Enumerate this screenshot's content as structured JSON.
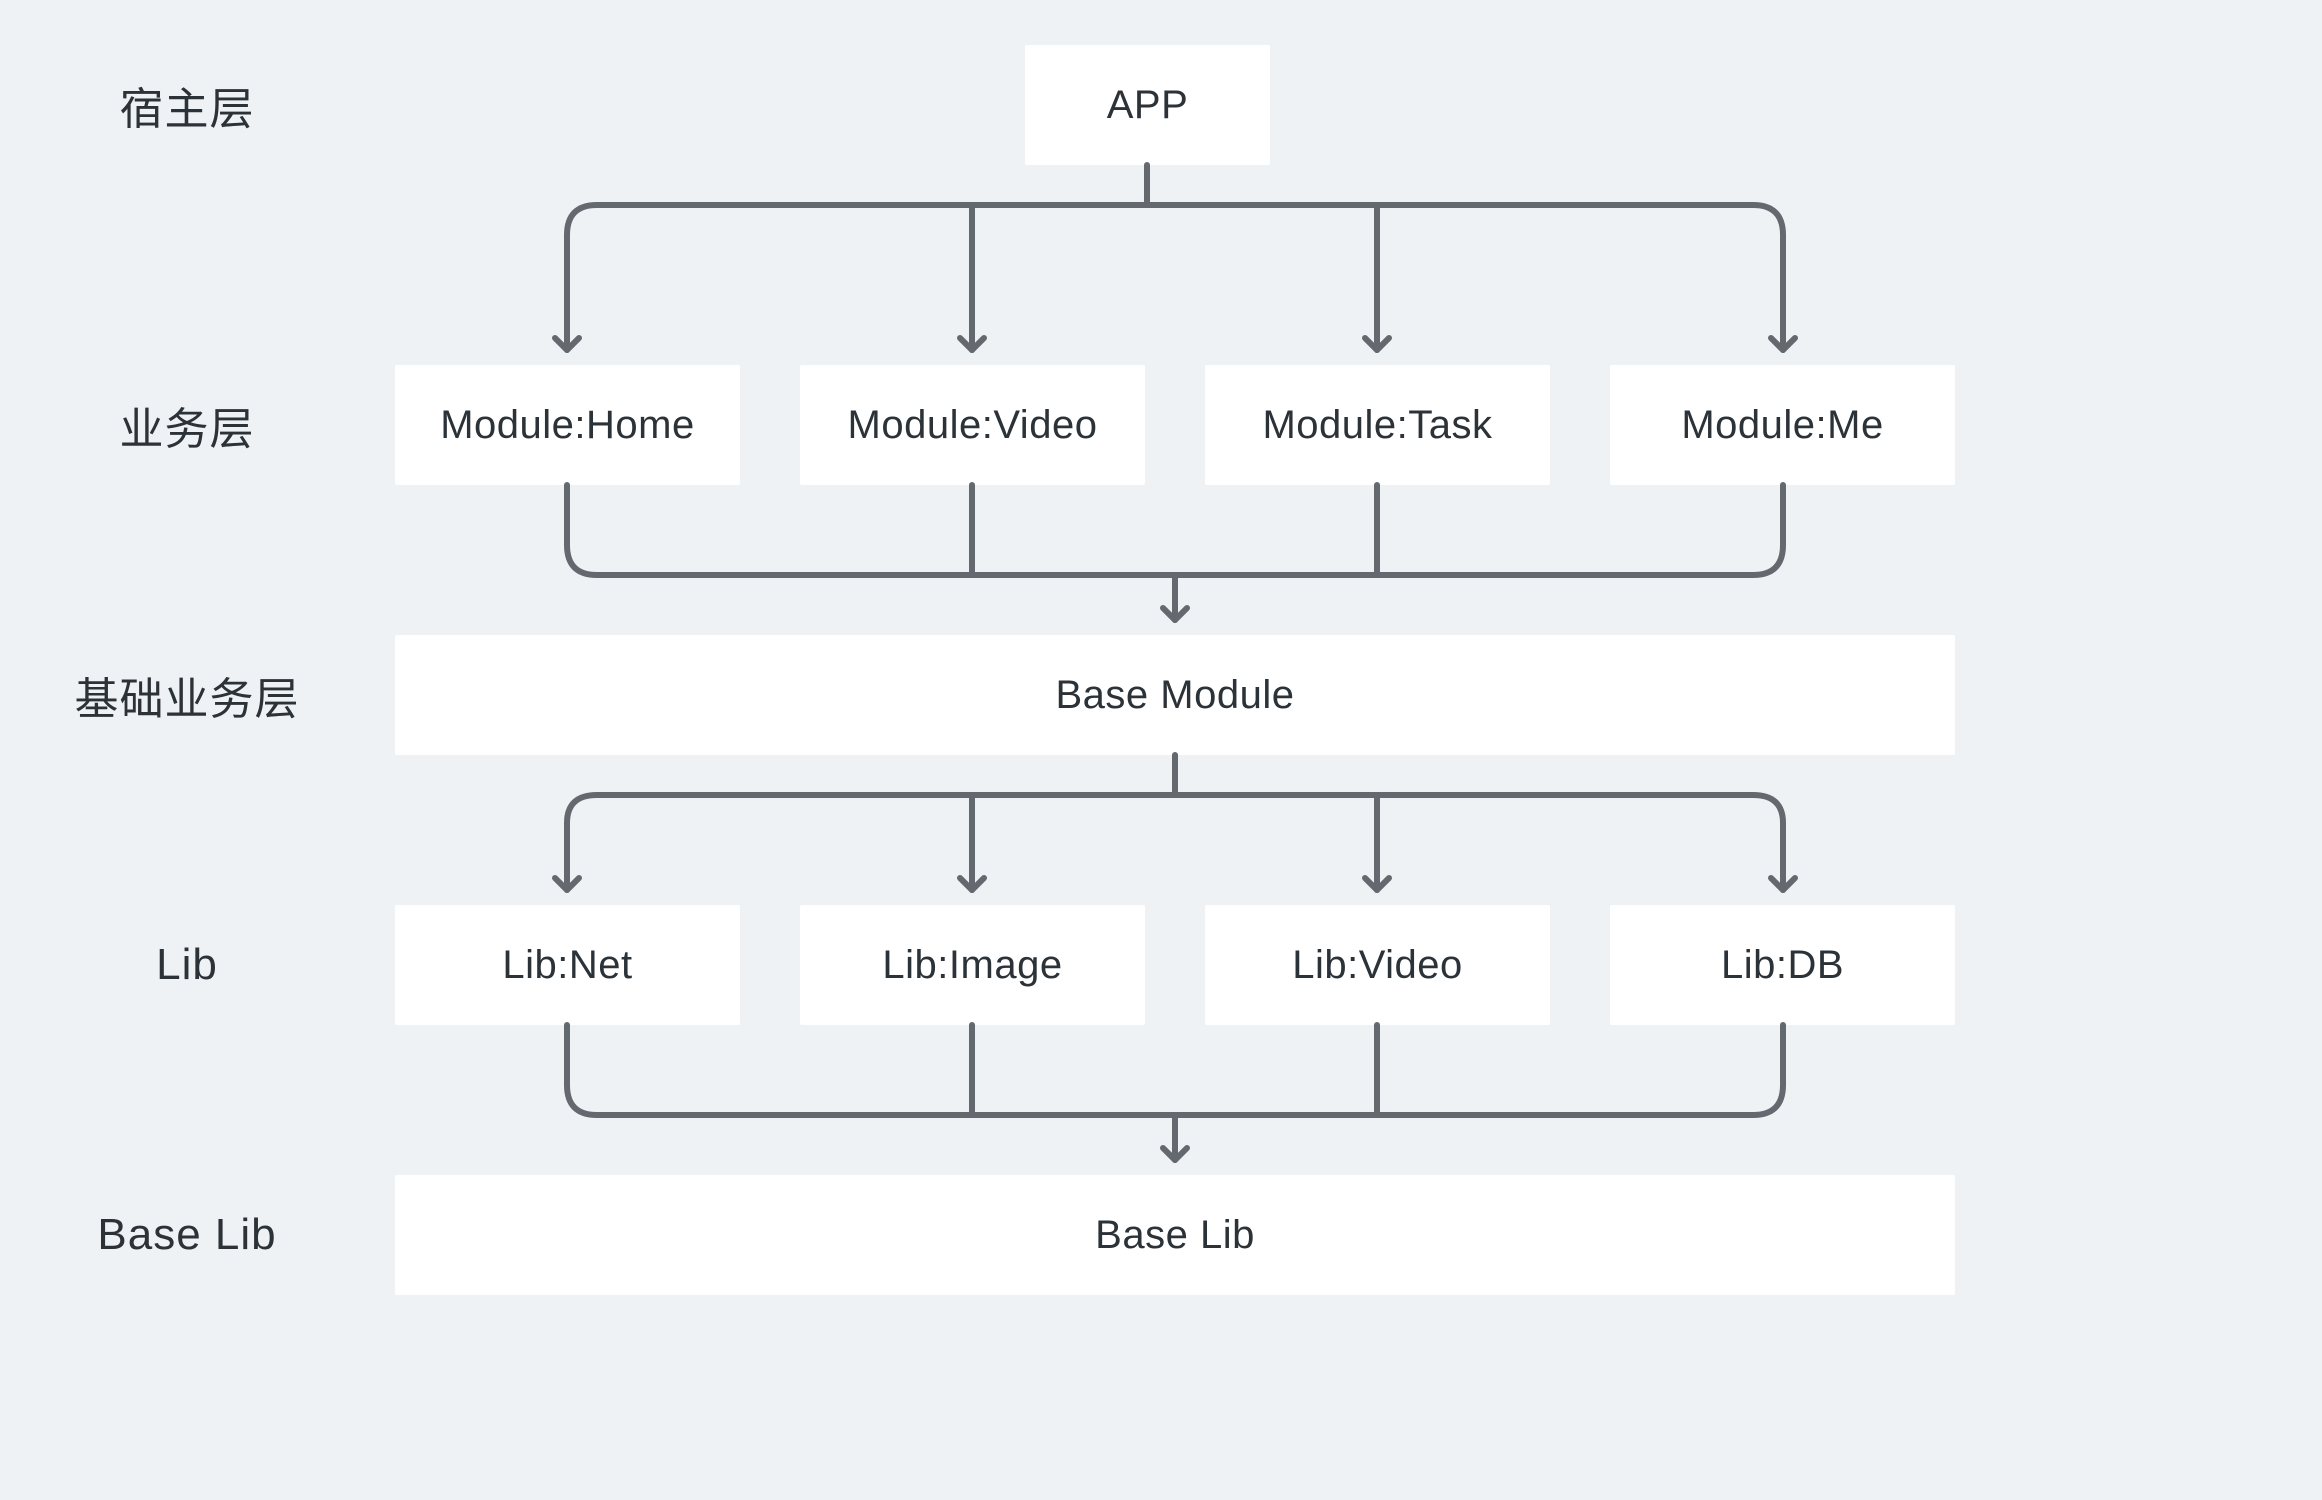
{
  "labels": {
    "layer1": "宿主层",
    "layer2": "业务层",
    "layer3": "基础业务层",
    "layer4": "Lib",
    "layer5": "Base Lib"
  },
  "nodes": {
    "app": "APP",
    "module_home": "Module:Home",
    "module_video": "Module:Video",
    "module_task": "Module:Task",
    "module_me": "Module:Me",
    "base_module": "Base Module",
    "lib_net": "Lib:Net",
    "lib_image": "Lib:Image",
    "lib_video": "Lib:Video",
    "lib_db": "Lib:DB",
    "base_lib": "Base Lib"
  },
  "colors": {
    "arrow": "#63696F",
    "bg": "#EFF2F4",
    "box": "#FFFFFF",
    "text": "#2B3238"
  }
}
